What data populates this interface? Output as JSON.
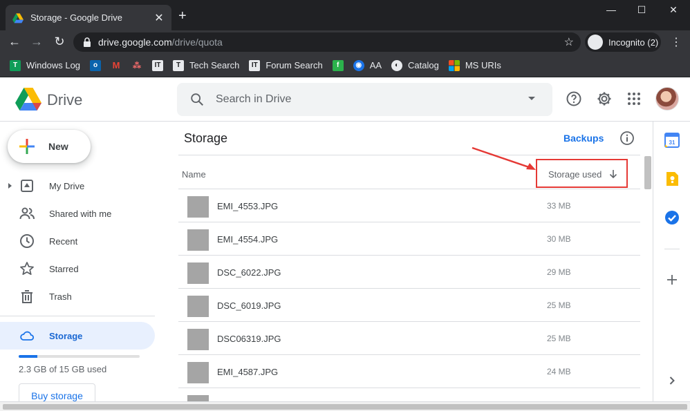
{
  "browser": {
    "tab_title": "Storage - Google Drive",
    "url_domain": "drive.google.com",
    "url_path": "/drive/quota",
    "incognito_label": "Incognito (2)",
    "bookmarks": [
      {
        "label": "Windows Log",
        "icon": "windows-log-icon",
        "color": "#0f9d58"
      },
      {
        "label": "",
        "icon": "outlook-icon",
        "color": "#0a64ad"
      },
      {
        "label": "",
        "icon": "gmail-icon",
        "color": "#ea4335"
      },
      {
        "label": "",
        "icon": "asana-icon",
        "color": "#f06a6a"
      },
      {
        "label": "",
        "icon": "techbook-icon",
        "color": "#e8eaed"
      },
      {
        "label": "Tech Search",
        "icon": "techsearch-icon",
        "color": "#e8eaed"
      },
      {
        "label": "Forum Search",
        "icon": "forum-icon",
        "color": "#e8eaed"
      },
      {
        "label": "",
        "icon": "feedly-icon",
        "color": "#2bb24c"
      },
      {
        "label": "AA",
        "icon": "aa-icon",
        "color": "#1a73e8"
      },
      {
        "label": "Catalog",
        "icon": "globe-icon",
        "color": "#e8eaed"
      },
      {
        "label": "MS URIs",
        "icon": "microsoft-icon",
        "color": "#f25022"
      }
    ]
  },
  "drive": {
    "app_name": "Drive",
    "search_placeholder": "Search in Drive",
    "new_label": "New",
    "nav": [
      {
        "label": "My Drive",
        "icon": "my-drive-icon"
      },
      {
        "label": "Shared with me",
        "icon": "shared-icon"
      },
      {
        "label": "Recent",
        "icon": "recent-icon"
      },
      {
        "label": "Starred",
        "icon": "star-icon"
      },
      {
        "label": "Trash",
        "icon": "trash-icon"
      }
    ],
    "storage_label": "Storage",
    "quota_text": "2.3 GB of 15 GB used",
    "quota_fraction": 0.153,
    "buy_label": "Buy storage"
  },
  "main": {
    "title": "Storage",
    "backups_label": "Backups",
    "col_name": "Name",
    "col_storage": "Storage used",
    "files": [
      {
        "name": "EMI_4553.JPG",
        "size": "33 MB"
      },
      {
        "name": "EMI_4554.JPG",
        "size": "30 MB"
      },
      {
        "name": "DSC_6022.JPG",
        "size": "29 MB"
      },
      {
        "name": "DSC_6019.JPG",
        "size": "25 MB"
      },
      {
        "name": "DSC06319.JPG",
        "size": "25 MB"
      },
      {
        "name": "EMI_4587.JPG",
        "size": "24 MB"
      },
      {
        "name": "",
        "size": ""
      }
    ]
  },
  "colors": {
    "accent": "#1a73e8",
    "highlight_red": "#e53935"
  }
}
